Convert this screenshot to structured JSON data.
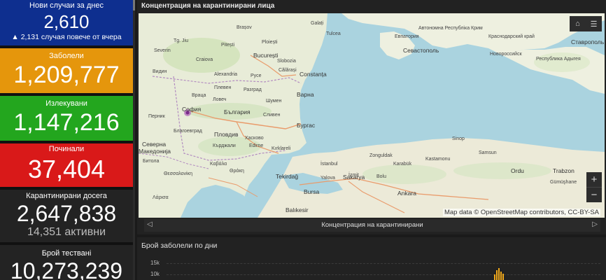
{
  "cards": {
    "new_cases": {
      "title": "Нови случаи за днес",
      "value": "2,610",
      "sub": "▲ 2,131 случая повече от вчера",
      "color": "#0e2f8f"
    },
    "infected": {
      "title": "Заболели",
      "value": "1,209,777",
      "color": "#e5960c"
    },
    "recovered": {
      "title": "Излекувани",
      "value": "1,147,216",
      "color": "#23a61e"
    },
    "deceased": {
      "title": "Починали",
      "value": "37,404",
      "color": "#d91919"
    },
    "quarantined": {
      "title": "Карантинирани досега",
      "value": "2,647,838",
      "sub": "14,351 активни",
      "color": "#232323"
    },
    "tests": {
      "title": "Брой тестванi",
      "value": "10,273,239",
      "color": "#232323"
    }
  },
  "map_panel": {
    "title": "Концентрация на карантинирани лица",
    "attribution": "Map data © OpenStreetMap contributors, CC-BY-SA",
    "nav_label": "Концентрация на карантинирани",
    "home_icon": "home-icon",
    "list_icon": "list-icon",
    "zoom_in": "+",
    "zoom_out": "−",
    "nav_prev": "◁",
    "nav_next": "▷",
    "labels": {
      "galati": "Galați",
      "tulcea": "Tulcea",
      "brasov": "Brașov",
      "ploiesti": "Ploiești",
      "pitesti": "Pitești",
      "bucuresti": "București",
      "slobozia": "Slobozia",
      "constanta": "Constanța",
      "craiova": "Craiova",
      "tg_jiu": "Tg. Jiu",
      "severin": "Severin",
      "calarasi": "Călărași",
      "ruse": "Русе",
      "alexandria": "Alexandria",
      "vidin": "Видин",
      "pleven": "Плевен",
      "razgrad": "Разград",
      "varna": "Варна",
      "shumen": "Шумен",
      "vratsa": "Враца",
      "lovech": "Ловеч",
      "sofia": "София",
      "bulgaria": "България",
      "sliven": "Сливен",
      "pernik": "Перник",
      "burgas": "Бургас",
      "blagoevgrad": "Благоевград",
      "plovdiv": "Пловдив",
      "haskovo": "Хасково",
      "kardzhali": "Кърджали",
      "edirne": "Edirne",
      "kirklareli": "Kırklareli",
      "makedonija": "Македонија",
      "severna": "Северна",
      "bitola": "Битола",
      "tekirdag": "Tekirdağ",
      "istanbul": "İstanbul",
      "izmit": "İzmit",
      "sakarya": "Sakarya",
      "bolu": "Bolu",
      "zonguldak": "Zonguldak",
      "karabuk": "Karabük",
      "kastamonu": "Kastamonu",
      "sinop": "Sinop",
      "samsun": "Samsun",
      "ordu": "Ordu",
      "trabzon": "Trabzon",
      "gumushane": "Gümüşhane",
      "ankara": "Ankara",
      "bursa": "Bursa",
      "balikesir": "Balıkesir",
      "yalova": "Yalova",
      "sevastopol": "Севастополь",
      "evpatoria": "Евпатория",
      "krasnodar": "Краснодарский край",
      "stavropol": "Ставрополь",
      "novorossiysk": "Новороссийск",
      "adygeya": "Республика Адыгея",
      "crimea": "Автономна Республіка Крим",
      "thessaloniki": "Θεσσαλονίκη",
      "larisa": "Λάρισα",
      "kavala": "Καβάλα",
      "nikoloa": "Θράκη"
    }
  },
  "chart_panel": {
    "title": "Брой заболели по дни",
    "yticks": [
      "15k",
      "10k"
    ]
  }
}
